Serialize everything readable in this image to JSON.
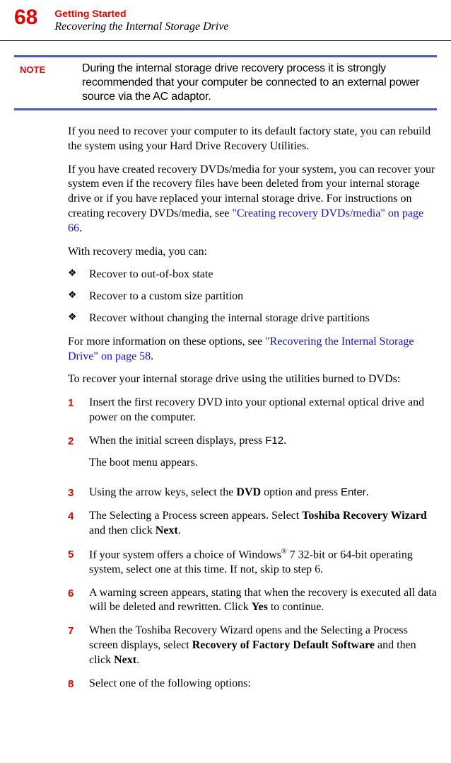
{
  "header": {
    "pageNum": "68",
    "chapter": "Getting Started",
    "section": "Recovering the Internal Storage Drive"
  },
  "note": {
    "label": "NOTE",
    "text": "During the internal storage drive recovery process it is strongly recommended that your computer be connected to an external power source via the AC adaptor."
  },
  "para1": "If you need to recover your computer to its default factory state, you can rebuild the system using your Hard Drive Recovery Utilities.",
  "para2_pre": "If you have created recovery DVDs/media for your system, you can recover your system even if the recovery files have been deleted from your internal storage drive or if you have replaced your internal storage drive. For instructions on creating recovery DVDs/media, see ",
  "para2_link": "\"Creating recovery DVDs/media\" on page 66",
  "para2_post": ".",
  "para3": "With recovery media, you can:",
  "bullets": [
    "Recover to out-of-box state",
    "Recover to a custom size partition",
    "Recover without changing the internal storage drive partitions"
  ],
  "para4_pre": "For more information on these options, see ",
  "para4_link": "\"Recovering the Internal Storage Drive\" on page 58",
  "para4_post": ".",
  "para5": "To recover your internal storage drive using the utilities burned to DVDs:",
  "steps": {
    "s1": "Insert the first recovery DVD into your optional external optical drive and power on the computer.",
    "s2a": "When the initial screen displays, press ",
    "s2key": "F12",
    "s2b": ".",
    "s2c": "The boot menu appears.",
    "s3a": "Using the arrow keys, select the ",
    "s3bold": "DVD",
    "s3b": " option and press ",
    "s3key": "Enter",
    "s3c": ".",
    "s4a": "The Selecting a Process screen appears. Select ",
    "s4bold": "Toshiba Recovery Wizard",
    "s4b": " and then click ",
    "s4bold2": "Next",
    "s4c": ".",
    "s5a": "If your system offers a choice of Windows",
    "s5sup": "®",
    "s5b": " 7 32-bit or 64-bit operating system, select one at this time. If not, skip to step 6.",
    "s6a": "A warning screen appears, stating that when the recovery is executed all data will be deleted and rewritten. Click ",
    "s6bold": "Yes",
    "s6b": " to continue.",
    "s7a": "When the Toshiba Recovery Wizard opens and the Selecting a Process screen displays, select ",
    "s7bold": "Recovery of Factory Default Software",
    "s7b": " and then click ",
    "s7bold2": "Next",
    "s7c": ".",
    "s8": "Select one of the following options:"
  },
  "nums": [
    "1",
    "2",
    "3",
    "4",
    "5",
    "6",
    "7",
    "8"
  ]
}
